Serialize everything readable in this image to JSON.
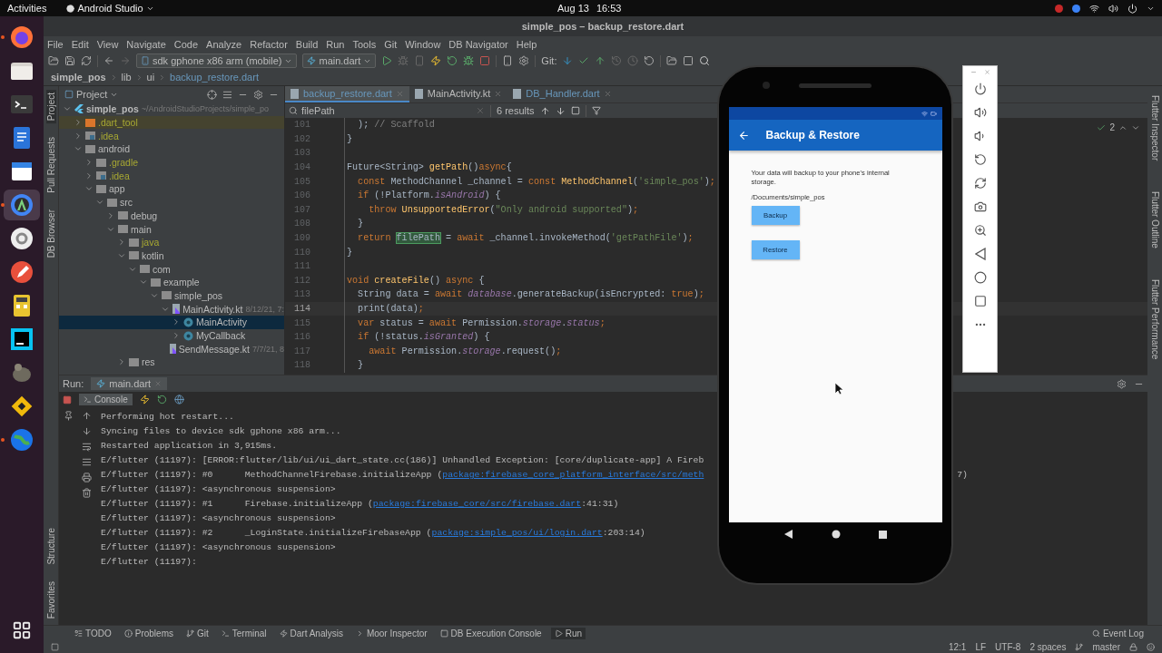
{
  "topbar": {
    "activities": "Activities",
    "app_menu": "Android Studio",
    "date": "Aug 13",
    "time": "16:53"
  },
  "dock": [
    {
      "kind": "browser",
      "running": true,
      "selected": false
    },
    {
      "kind": "files",
      "running": false,
      "selected": false
    },
    {
      "kind": "terminal",
      "running": false,
      "selected": false
    },
    {
      "kind": "document",
      "running": false,
      "selected": false
    },
    {
      "kind": "calendar",
      "running": false,
      "selected": false
    },
    {
      "kind": "studio",
      "running": true,
      "selected": true
    },
    {
      "kind": "settings",
      "running": false,
      "selected": false
    },
    {
      "kind": "pen",
      "running": false,
      "selected": false
    },
    {
      "kind": "calculator",
      "running": false,
      "selected": false
    },
    {
      "kind": "ide",
      "running": false,
      "selected": false
    },
    {
      "kind": "paint",
      "running": false,
      "selected": false
    },
    {
      "kind": "diamond",
      "running": false,
      "selected": false
    },
    {
      "kind": "globe",
      "running": true,
      "selected": false
    }
  ],
  "window": {
    "title": "simple_pos – backup_restore.dart"
  },
  "menu": [
    "File",
    "Edit",
    "View",
    "Navigate",
    "Code",
    "Analyze",
    "Refactor",
    "Build",
    "Run",
    "Tools",
    "Git",
    "Window",
    "DB Navigator",
    "Help"
  ],
  "toolbar": {
    "device": "sdk gphone x86 arm (mobile)",
    "run_config": "main.dart",
    "git_label": "Git:"
  },
  "breadcrumb": [
    {
      "label": "simple_pos",
      "bold": true,
      "modified": false
    },
    {
      "label": "lib",
      "bold": false,
      "modified": false
    },
    {
      "label": "ui",
      "bold": false,
      "modified": false
    },
    {
      "label": "backup_restore.dart",
      "bold": false,
      "modified": true
    }
  ],
  "left_tool_tabs": [
    {
      "label": "Project",
      "selected": true
    },
    {
      "label": "Pull Requests",
      "selected": false
    },
    {
      "label": "DB Browser",
      "selected": false
    }
  ],
  "left_tool_tabs_bottom": [
    {
      "label": "Structure",
      "selected": false
    },
    {
      "label": "Favorites",
      "selected": false
    }
  ],
  "project": {
    "title": "Project",
    "tree": [
      {
        "name": "simple_pos",
        "kind": "project",
        "expanded": true,
        "ignored": false,
        "selected": false,
        "meta": "~/AndroidStudioProjects/simple_po",
        "children": [
          {
            "name": ".dart_tool",
            "kind": "excluded-folder",
            "expanded": false,
            "ignored": true,
            "selected": false
          },
          {
            "name": ".idea",
            "kind": "idea-folder",
            "expanded": false,
            "ignored": true,
            "selected": false
          },
          {
            "name": "android",
            "kind": "folder",
            "expanded": true,
            "ignored": false,
            "selected": false,
            "children": [
              {
                "name": ".gradle",
                "kind": "folder",
                "expanded": false,
                "ignored": true,
                "selected": false
              },
              {
                "name": ".idea",
                "kind": "idea-folder",
                "expanded": false,
                "ignored": true,
                "selected": false
              },
              {
                "name": "app",
                "kind": "folder",
                "expanded": true,
                "ignored": false,
                "selected": false,
                "children": [
                  {
                    "name": "src",
                    "kind": "folder",
                    "expanded": true,
                    "ignored": false,
                    "selected": false,
                    "children": [
                      {
                        "name": "debug",
                        "kind": "folder",
                        "expanded": false,
                        "ignored": false,
                        "selected": false
                      },
                      {
                        "name": "main",
                        "kind": "folder",
                        "expanded": true,
                        "ignored": false,
                        "selected": false,
                        "children": [
                          {
                            "name": "java",
                            "kind": "folder",
                            "expanded": false,
                            "ignored": true,
                            "selected": false
                          },
                          {
                            "name": "kotlin",
                            "kind": "folder",
                            "expanded": true,
                            "ignored": false,
                            "selected": false,
                            "children": [
                              {
                                "name": "com",
                                "kind": "folder",
                                "expanded": true,
                                "ignored": false,
                                "selected": false,
                                "children": [
                                  {
                                    "name": "example",
                                    "kind": "folder",
                                    "expanded": true,
                                    "ignored": false,
                                    "selected": false,
                                    "children": [
                                      {
                                        "name": "simple_pos",
                                        "kind": "folder",
                                        "expanded": true,
                                        "ignored": false,
                                        "selected": false,
                                        "children": [
                                          {
                                            "name": "MainActivity.kt",
                                            "kind": "kotlin-file",
                                            "expanded": true,
                                            "ignored": false,
                                            "selected": false,
                                            "meta": "8/12/21, 7:",
                                            "children": [
                                              {
                                                "name": "MainActivity",
                                                "kind": "class",
                                                "expanded": false,
                                                "ignored": false,
                                                "selected": true
                                              },
                                              {
                                                "name": "MyCallback",
                                                "kind": "class",
                                                "expanded": false,
                                                "ignored": false,
                                                "selected": false
                                              }
                                            ]
                                          },
                                          {
                                            "name": "SendMessage.kt",
                                            "kind": "kotlin-file",
                                            "ignored": false,
                                            "selected": false,
                                            "meta": "7/7/21, 8"
                                          }
                                        ]
                                      }
                                    ]
                                  }
                                ]
                              }
                            ]
                          },
                          {
                            "name": "res",
                            "kind": "folder",
                            "expanded": false,
                            "ignored": false,
                            "selected": false
                          }
                        ]
                      }
                    ]
                  }
                ]
              }
            ]
          }
        ]
      }
    ]
  },
  "editor": {
    "tabs": [
      {
        "label": "backup_restore.dart",
        "selected": true,
        "modified": true
      },
      {
        "label": "MainActivity.kt",
        "selected": false,
        "modified": false
      },
      {
        "label": "DB_Handler.dart",
        "selected": false,
        "modified": true
      }
    ],
    "search": {
      "value": "filePath",
      "results": "6 results"
    },
    "inspection_count": "2",
    "lines": [
      {
        "number": "101",
        "current": false,
        "tokens": [
          {
            "kind": "plain",
            "text": "  ); "
          },
          {
            "kind": "comment",
            "text": "// Scaffold"
          }
        ]
      },
      {
        "number": "102",
        "current": false,
        "tokens": [
          {
            "kind": "plain",
            "text": "}"
          }
        ]
      },
      {
        "number": "103",
        "current": false
      },
      {
        "number": "104",
        "current": false,
        "tokens": [
          {
            "kind": "plain",
            "text": "Future<String> "
          },
          {
            "kind": "func",
            "text": "getPath"
          },
          {
            "kind": "plain",
            "text": "()"
          },
          {
            "kind": "keyword",
            "text": "async"
          },
          {
            "kind": "plain",
            "text": "{"
          }
        ]
      },
      {
        "number": "105",
        "current": false,
        "tokens": [
          {
            "kind": "keyword",
            "text": "  const "
          },
          {
            "kind": "plain",
            "text": "MethodChannel _channel = "
          },
          {
            "kind": "keyword",
            "text": "const "
          },
          {
            "kind": "func",
            "text": "MethodChannel"
          },
          {
            "kind": "plain",
            "text": "("
          },
          {
            "kind": "string",
            "text": "'simple_pos'"
          },
          {
            "kind": "plain",
            "text": ")"
          },
          {
            "kind": "keyword",
            "text": ";"
          }
        ]
      },
      {
        "number": "106",
        "current": false,
        "tokens": [
          {
            "kind": "keyword",
            "text": "  if "
          },
          {
            "kind": "plain",
            "text": "(!Platform."
          },
          {
            "kind": "field",
            "text": "isAndroid"
          },
          {
            "kind": "plain",
            "text": ") {"
          }
        ]
      },
      {
        "number": "107",
        "current": false,
        "tokens": [
          {
            "kind": "keyword",
            "text": "    throw "
          },
          {
            "kind": "func",
            "text": "UnsupportedError"
          },
          {
            "kind": "plain",
            "text": "("
          },
          {
            "kind": "string",
            "text": "\"Only android supported\""
          },
          {
            "kind": "plain",
            "text": ")"
          },
          {
            "kind": "keyword",
            "text": ";"
          }
        ]
      },
      {
        "number": "108",
        "current": false,
        "tokens": [
          {
            "kind": "plain",
            "text": "  }"
          }
        ]
      },
      {
        "number": "109",
        "current": false,
        "tokens": [
          {
            "kind": "keyword",
            "text": "  return "
          },
          {
            "kind": "match",
            "text": "filePath"
          },
          {
            "kind": "plain",
            "text": " = "
          },
          {
            "kind": "keyword",
            "text": "await "
          },
          {
            "kind": "plain",
            "text": "_channel.invokeMethod("
          },
          {
            "kind": "string",
            "text": "'getPathFile'"
          },
          {
            "kind": "plain",
            "text": ")"
          },
          {
            "kind": "keyword",
            "text": ";"
          }
        ]
      },
      {
        "number": "110",
        "current": false,
        "tokens": [
          {
            "kind": "plain",
            "text": "}"
          }
        ]
      },
      {
        "number": "111",
        "current": false
      },
      {
        "number": "112",
        "current": false,
        "tokens": [
          {
            "kind": "keyword",
            "text": "void "
          },
          {
            "kind": "func",
            "text": "createFile"
          },
          {
            "kind": "plain",
            "text": "() "
          },
          {
            "kind": "keyword",
            "text": "async "
          },
          {
            "kind": "plain",
            "text": "{"
          }
        ]
      },
      {
        "number": "113",
        "current": false,
        "tokens": [
          {
            "kind": "plain",
            "text": "  String data = "
          },
          {
            "kind": "keyword",
            "text": "await "
          },
          {
            "kind": "field",
            "text": "database"
          },
          {
            "kind": "plain",
            "text": ".generateBackup(isEncrypted: "
          },
          {
            "kind": "keyword",
            "text": "true"
          },
          {
            "kind": "plain",
            "text": ")"
          },
          {
            "kind": "keyword",
            "text": ";"
          }
        ]
      },
      {
        "number": "114",
        "current": true,
        "tokens": [
          {
            "kind": "plain",
            "text": "  print(data)"
          },
          {
            "kind": "keyword",
            "text": ";"
          }
        ]
      },
      {
        "number": "115",
        "current": false,
        "tokens": [
          {
            "kind": "keyword",
            "text": "  var "
          },
          {
            "kind": "plain",
            "text": "status = "
          },
          {
            "kind": "keyword",
            "text": "await "
          },
          {
            "kind": "plain",
            "text": "Permission."
          },
          {
            "kind": "field",
            "text": "storage"
          },
          {
            "kind": "plain",
            "text": "."
          },
          {
            "kind": "field",
            "text": "status"
          },
          {
            "kind": "keyword",
            "text": ";"
          }
        ]
      },
      {
        "number": "116",
        "current": false,
        "tokens": [
          {
            "kind": "keyword",
            "text": "  if "
          },
          {
            "kind": "plain",
            "text": "(!status."
          },
          {
            "kind": "field",
            "text": "isGranted"
          },
          {
            "kind": "plain",
            "text": ") {"
          }
        ]
      },
      {
        "number": "117",
        "current": false,
        "tokens": [
          {
            "kind": "keyword",
            "text": "    await "
          },
          {
            "kind": "plain",
            "text": "Permission."
          },
          {
            "kind": "field",
            "text": "storage"
          },
          {
            "kind": "plain",
            "text": ".request()"
          },
          {
            "kind": "keyword",
            "text": ";"
          }
        ]
      },
      {
        "number": "118",
        "current": false,
        "tokens": [
          {
            "kind": "plain",
            "text": "  }"
          }
        ]
      }
    ]
  },
  "right_tool_tabs": [
    "Flutter Inspector",
    "Flutter Outline",
    "Flutter Performance"
  ],
  "run": {
    "label": "Run:",
    "tab": "main.dart",
    "console_tab": "Console",
    "lines": [
      [
        {
          "kind": "text",
          "text": "Performing hot restart..."
        }
      ],
      [
        {
          "kind": "text",
          "text": "Syncing files to device sdk gphone x86 arm..."
        }
      ],
      [
        {
          "kind": "text",
          "text": "Restarted application in 3,915ms."
        }
      ],
      [
        {
          "kind": "text",
          "text": "E/flutter (11197): [ERROR:flutter/lib/ui/ui_dart_state.cc(186)] Unhandled Exception: [core/duplicate-app] A Fireb"
        }
      ],
      [
        {
          "kind": "text",
          "text": "E/flutter (11197): #0      MethodChannelFirebase.initializeApp ("
        },
        {
          "kind": "link",
          "text": "package:firebase_core_platform_interface/src/meth"
        },
        {
          "kind": "tail",
          "text": "7)"
        }
      ],
      [
        {
          "kind": "text",
          "text": "E/flutter (11197): <asynchronous suspension>"
        }
      ],
      [
        {
          "kind": "text",
          "text": "E/flutter (11197): #1      Firebase.initializeApp ("
        },
        {
          "kind": "link",
          "text": "package:firebase_core/src/firebase.dart"
        },
        {
          "kind": "text",
          "text": ":41:31)"
        }
      ],
      [
        {
          "kind": "text",
          "text": "E/flutter (11197): <asynchronous suspension>"
        }
      ],
      [
        {
          "kind": "text",
          "text": "E/flutter (11197): #2      _LoginState.initializeFirebaseApp ("
        },
        {
          "kind": "link",
          "text": "package:simple_pos/ui/login.dart"
        },
        {
          "kind": "text",
          "text": ":203:14)"
        }
      ],
      [
        {
          "kind": "text",
          "text": "E/flutter (11197): <asynchronous suspension>"
        }
      ],
      [
        {
          "kind": "text",
          "text": "E/flutter (11197):"
        }
      ]
    ]
  },
  "phone": {
    "title": "Backup & Restore",
    "message": "Your data will backup to your phone's internal storage.",
    "path": "/Documents/simple_pos",
    "buttons": [
      "Backup",
      "Restore"
    ]
  },
  "bottom_tools": [
    {
      "label": "TODO",
      "selected": false
    },
    {
      "label": "Problems",
      "selected": false
    },
    {
      "label": "Git",
      "selected": false
    },
    {
      "label": "Terminal",
      "selected": false
    },
    {
      "label": "Dart Analysis",
      "selected": false
    },
    {
      "label": "Moor Inspector",
      "selected": false
    },
    {
      "label": "DB Execution Console",
      "selected": false
    },
    {
      "label": "Run",
      "selected": true
    }
  ],
  "event_log": "Event Log",
  "status_bar": {
    "position": "12:1",
    "line_separator": "LF",
    "encoding": "UTF-8",
    "indent": "2 spaces",
    "branch": "master"
  }
}
